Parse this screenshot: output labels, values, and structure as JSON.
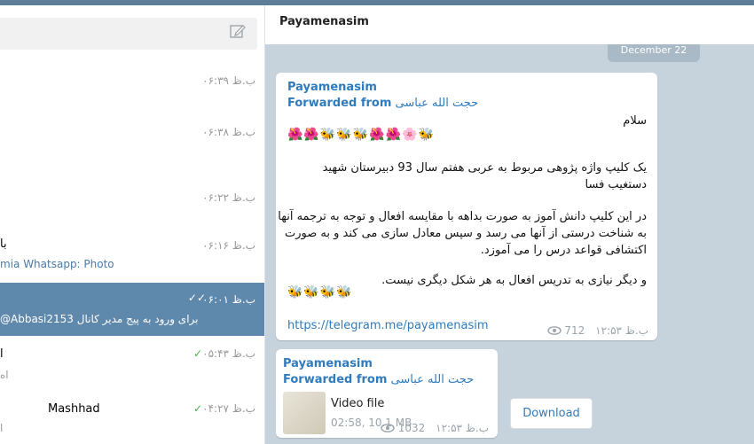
{
  "sidebar": {
    "chats": [
      {
        "time": "ب.ظ ۰۶:۳۹"
      },
      {
        "time": "ب.ظ ۰۶:۳۸"
      },
      {
        "time": "ب.ظ ۰۶:۲۲"
      },
      {
        "time": "ب.ظ ۰۶:۱۶",
        "title_fragment": "با",
        "preview": "mia Whatsapp: Photo"
      },
      {
        "time": "ب.ظ ۰۶:۰۱",
        "preview": "@Abbasi2153 برای ورود به پیج مدیر کانال"
      },
      {
        "time": "ب.ظ ۰۵:۴۳",
        "title_fragment": "ا",
        "preview": "اه"
      },
      {
        "time": "ب.ظ ۰۴:۲۷",
        "title": "Mashhad",
        "preview": "ا"
      }
    ]
  },
  "chat": {
    "title": "Payamenasim",
    "date_pill": "December 22",
    "message1": {
      "sender": "Payamenasim",
      "forwarded_label": "Forwarded from",
      "forwarded_name": "حجت الله عباسی",
      "greeting": "سلام",
      "emojis1": "🌺🌺🐝🐝🐝🌺🌺🌸🐝",
      "para1_l1": "یک کلیپ واژه پژوهی مربوط به عربی هفتم سال 93 دبیرستان شهید",
      "para1_l2": "دستغیب فسا",
      "para2_l1": "در این کلیپ دانش آموز به صورت بداهه با مقایسه افعال و توجه به ترجمه آنها",
      "para2_l2": "به شناخت درستی از آنها می رسد و سپس معادل سازی می کند و به صورت",
      "para2_l3": "اکتشافی قواعد درس را می آموزد.",
      "para3": "و دیگر نیازی به تدریس افعال به هر شکل دیگری نیست.",
      "emojis2": "🐝🐝🐝🐝",
      "link": "https://telegram.me/payamenasim",
      "views": "712",
      "time": "ب.ظ ۱۲:۵۳"
    },
    "message2": {
      "sender": "Payamenasim",
      "forwarded_label": "Forwarded from",
      "forwarded_name": "حجت الله عباسی",
      "file_title": "Video file",
      "file_info": "02:58, 10.1 MB",
      "views": "1032",
      "time": "ب.ظ ۱۲:۵۳"
    },
    "download_label": "Download"
  },
  "colors": {
    "accent": "#2f7bbc",
    "active_chat": "#5f88ad",
    "check_green": "#4cae4c"
  }
}
